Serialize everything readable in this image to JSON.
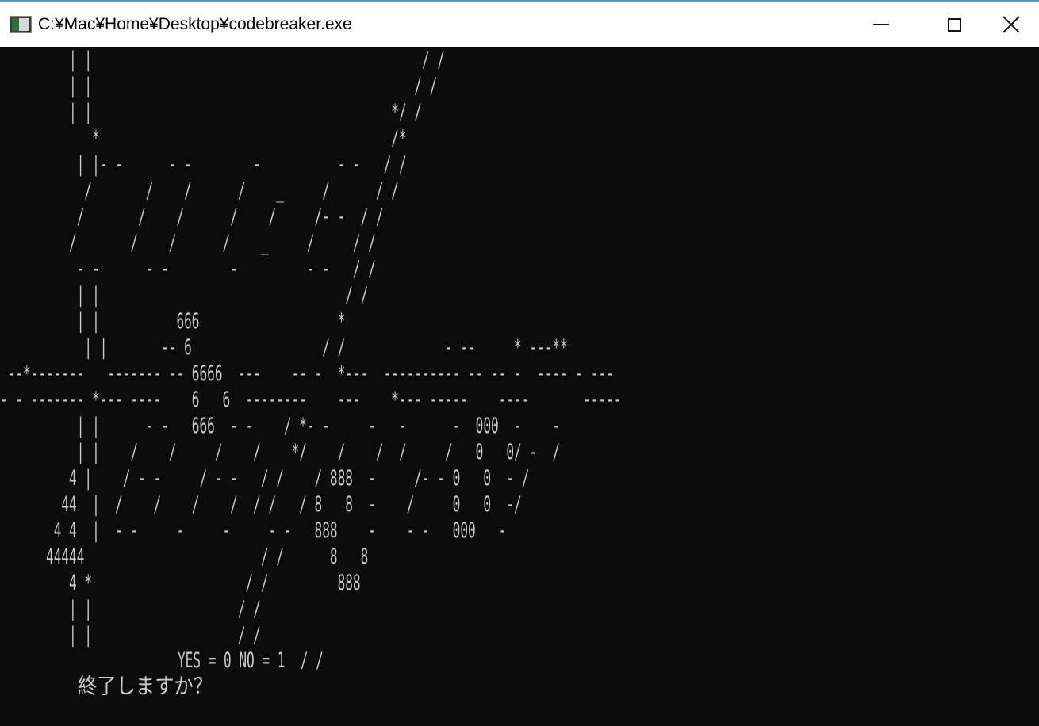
{
  "window": {
    "title": "C:¥Mac¥Home¥Desktop¥codebreaker.exe",
    "icon": "console-app-icon",
    "controls": {
      "minimize": "minimize-icon",
      "maximize": "maximize-icon",
      "close": "close-icon"
    }
  },
  "console": {
    "background": "#0c0c0c",
    "foreground": "#cccccc",
    "art": "         | |                                           / /\n         | |                                          / /\n         | |                                       */ /\n            *                                      /*\n          | |- -      - -        -          - -   / /\n           /       /    /      /    _     /      / /\n          /       /    /      /    /     /- -  / /\n         /       /    /      /    _     /     / /\n          - -      - -        -         - -   / /\n          | |                                / /\n          | |          666                  *\n           | |       -- 6                 / /             - --     * ---**\n --*-------   ------- -- 6666  ---    -- -  *---  ---------- -- -- -  ---- - ---\n- - ------- *--- ----    6   6  --------    ---    *--- -----    ----       -----\n          | |      - -   666  - -    / *- -     -   -      -  000  -    -\n          | |    /    /     /    /    */    /    /  /     /   0   0/ -  /\n         4 |    / - -     / - -   / /    / 888  -     /- - 0   0  - /\n        44  |  /    /    /    /  / /   / 8   8  -    /     0   0  -/\n       4 4  |  - -     -     -     - -   888    -    - -   000   -\n      44444                       / /      8   8\n         4 *                    / /         888\n         | |                   / /\n         | |                   / /"
  },
  "prompt": {
    "question": "終了しますか？",
    "options": "YES = 0 NO = 1",
    "trail": "  / /"
  }
}
